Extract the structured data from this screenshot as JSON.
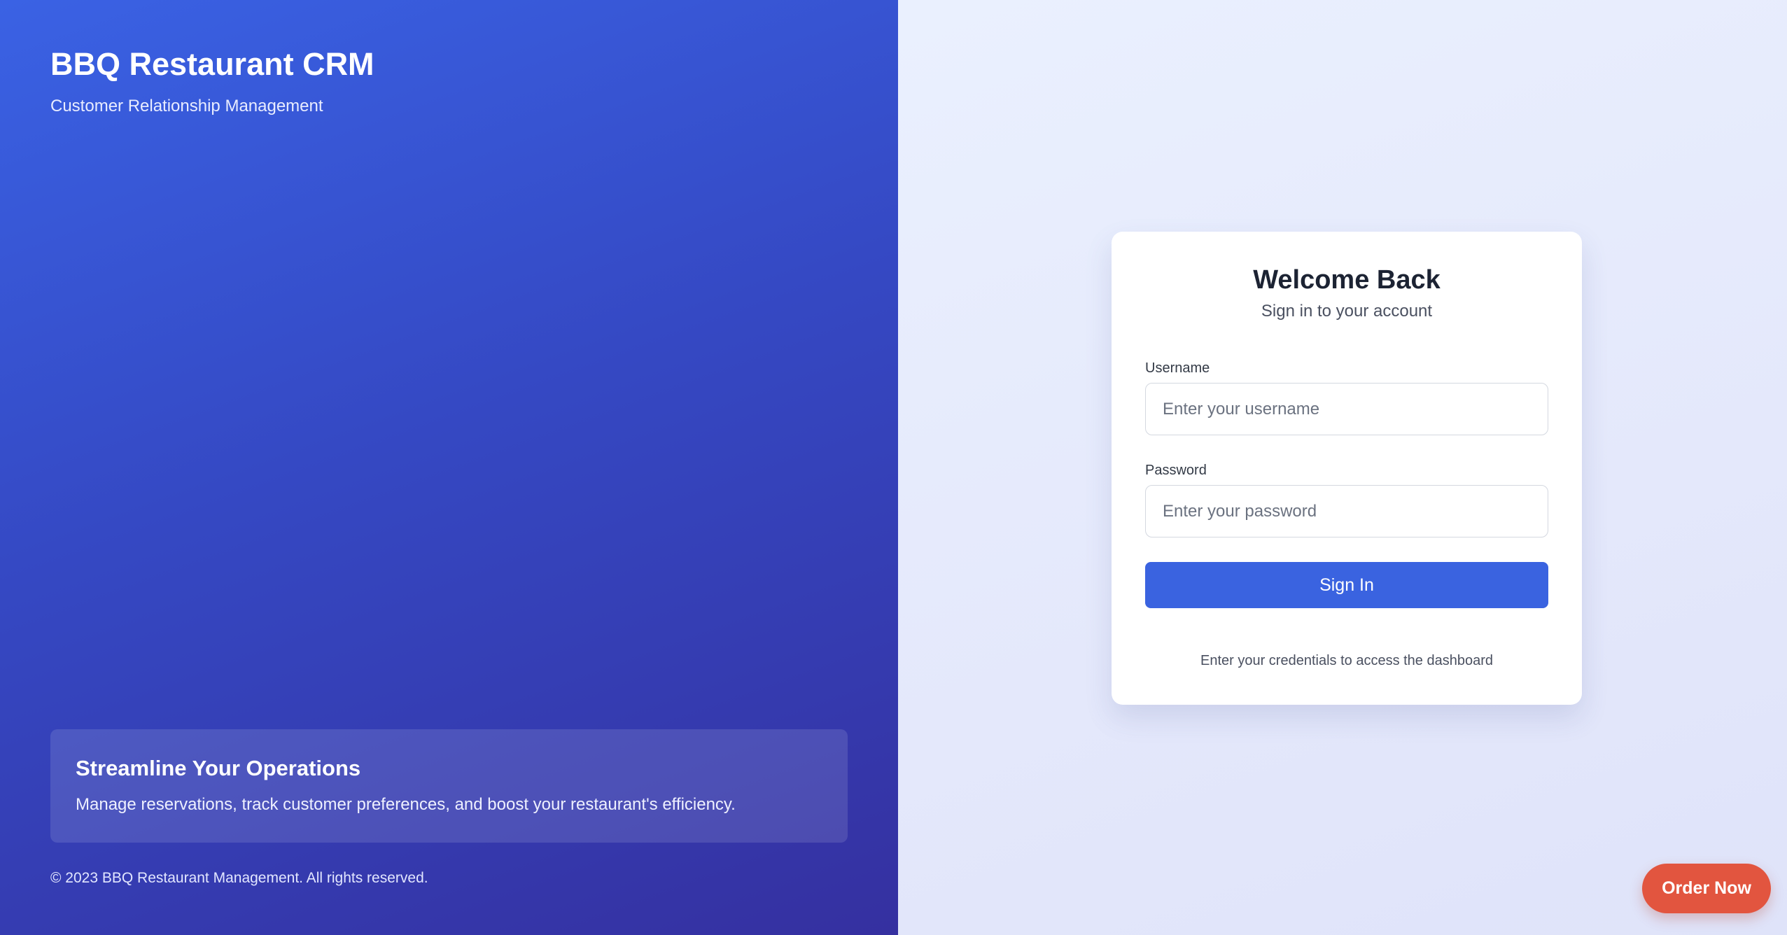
{
  "brand": {
    "title": "BBQ Restaurant CRM",
    "subtitle": "Customer Relationship Management"
  },
  "promo": {
    "heading": "Streamline Your Operations",
    "text": "Manage reservations, track customer preferences, and boost your restaurant's efficiency."
  },
  "footer": {
    "copyright": "© 2023 BBQ Restaurant Management. All rights reserved."
  },
  "login": {
    "title": "Welcome Back",
    "subtitle": "Sign in to your account",
    "username_label": "Username",
    "username_placeholder": "Enter your username",
    "username_value": "",
    "password_label": "Password",
    "password_placeholder": "Enter your password",
    "password_value": "",
    "submit_label": "Sign In",
    "hint": "Enter your credentials to access the dashboard"
  },
  "floating": {
    "order_label": "Order Now"
  },
  "colors": {
    "primary": "#3a63e0",
    "left_gradient_start": "#3a62e4",
    "left_gradient_end": "#3530a0",
    "right_background": "#eaf0fe",
    "order_button": "#e2553f",
    "heading_text": "#1c2333"
  }
}
